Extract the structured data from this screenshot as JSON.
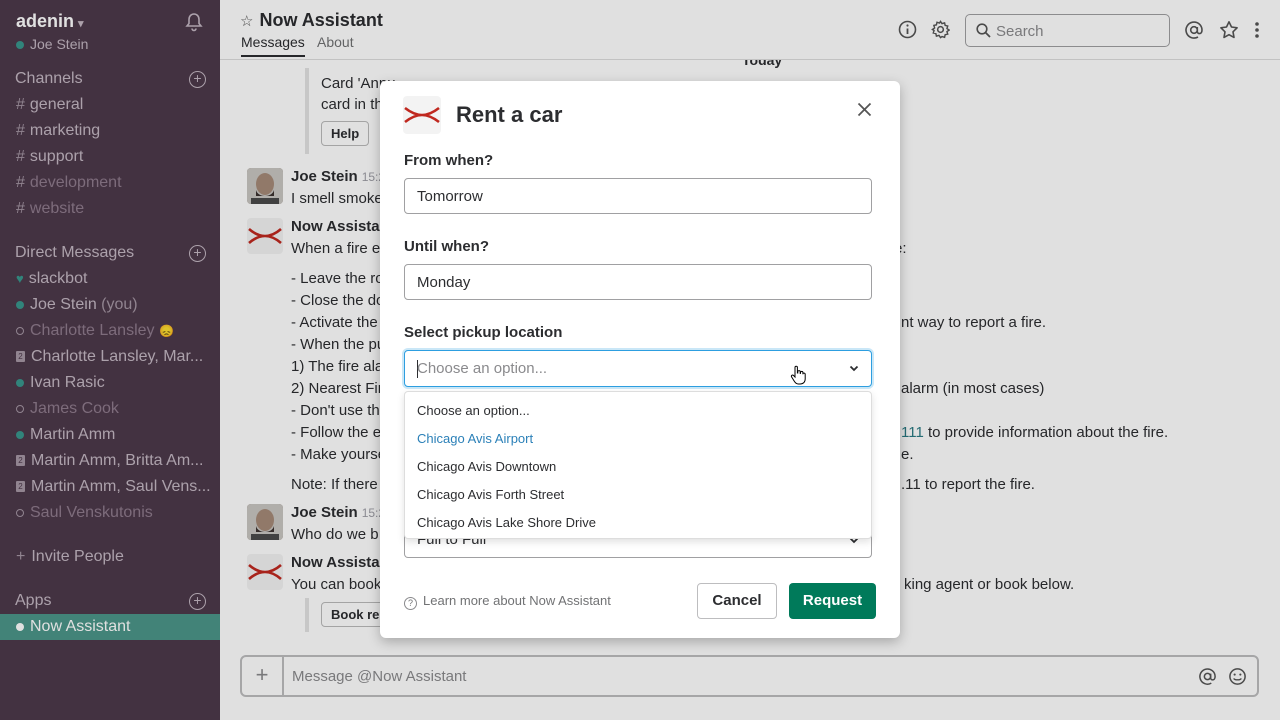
{
  "workspace": {
    "name": "adenin",
    "user": "Joe Stein"
  },
  "channels": {
    "heading": "Channels",
    "items": [
      "general",
      "marketing",
      "support",
      "development",
      "website"
    ]
  },
  "direct_messages": {
    "heading": "Direct Messages",
    "items": [
      {
        "label": "slackbot",
        "suffix": ""
      },
      {
        "label": "Joe Stein",
        "suffix": "(you)"
      },
      {
        "label": "Charlotte Lansley",
        "suffix": ""
      },
      {
        "label": "Charlotte Lansley, Mar...",
        "suffix": ""
      },
      {
        "label": "Ivan Rasic",
        "suffix": ""
      },
      {
        "label": "James Cook",
        "suffix": ""
      },
      {
        "label": "Martin Amm",
        "suffix": ""
      },
      {
        "label": "Martin Amm, Britta Am...",
        "suffix": ""
      },
      {
        "label": "Martin Amm, Saul Vens...",
        "suffix": ""
      },
      {
        "label": "Saul Venskutonis",
        "suffix": ""
      }
    ],
    "invite": "Invite People"
  },
  "apps": {
    "heading": "Apps",
    "items": [
      "Now Assistant"
    ]
  },
  "header": {
    "title": "Now Assistant",
    "tabs": [
      "Messages",
      "About"
    ],
    "search_placeholder": "Search"
  },
  "messages": {
    "date_divider": "Today",
    "card_text_1": "Card 'Annu                              Slash Chat Click                     card in the",
    "card_text_1a": "Card 'Annu",
    "card_text_1b": "card in the",
    "help_button": "Help",
    "m1_name": "Joe Stein",
    "m1_time": "15:2",
    "m1_text": "I smell smoke",
    "m2_name": "Now Assistan",
    "m2_text": "When a fire e",
    "m2_text_r": "e:",
    "lines_left": [
      "- Leave the ro",
      "- Close the do",
      "- Activate the",
      "- When the pu",
      "1) The fire ala",
      "2) Nearest Fir",
      "- Don't use th",
      "- Follow the e",
      "- Make yourse"
    ],
    "line_r_activate": "nt way to report a fire.",
    "line_r_nearest": "alarm (in most cases)",
    "line_r_follow_num": "111",
    "line_r_follow": " to provide information about the fire.",
    "line_r_make": "e.",
    "note_left": "Note: If there",
    "note_right": ".11 to report the fire.",
    "m3_name": "Joe Stein",
    "m3_time": "15:2",
    "m3_text": "Who do we b",
    "m4_name": "Now Assistan",
    "m4_text": "You can book",
    "m4_text_r": "king agent or book below.",
    "book_button": "Book renta"
  },
  "composer": {
    "placeholder": "Message @Now Assistant"
  },
  "modal": {
    "title": "Rent a car",
    "from_label": "From when?",
    "from_value": "Tomorrow",
    "until_label": "Until when?",
    "until_value": "Monday",
    "pickup_label": "Select pickup location",
    "pickup_placeholder": "Choose an option...",
    "options": [
      "Choose an option...",
      "Chicago Avis Airport",
      "Chicago Avis Downtown",
      "Chicago Avis Forth Street",
      "Chicago Avis Lake Shore Drive"
    ],
    "second_select_value": "Full to Full",
    "learn_more": "Learn more about Now Assistant",
    "cancel": "Cancel",
    "request": "Request"
  },
  "colors": {
    "sidebar": "#4d394b",
    "active_item": "#4c9689",
    "presence": "#38978d",
    "request_button": "#007a5a",
    "focus": "#2d9ee0",
    "option_highlight": "#2b80b8"
  }
}
